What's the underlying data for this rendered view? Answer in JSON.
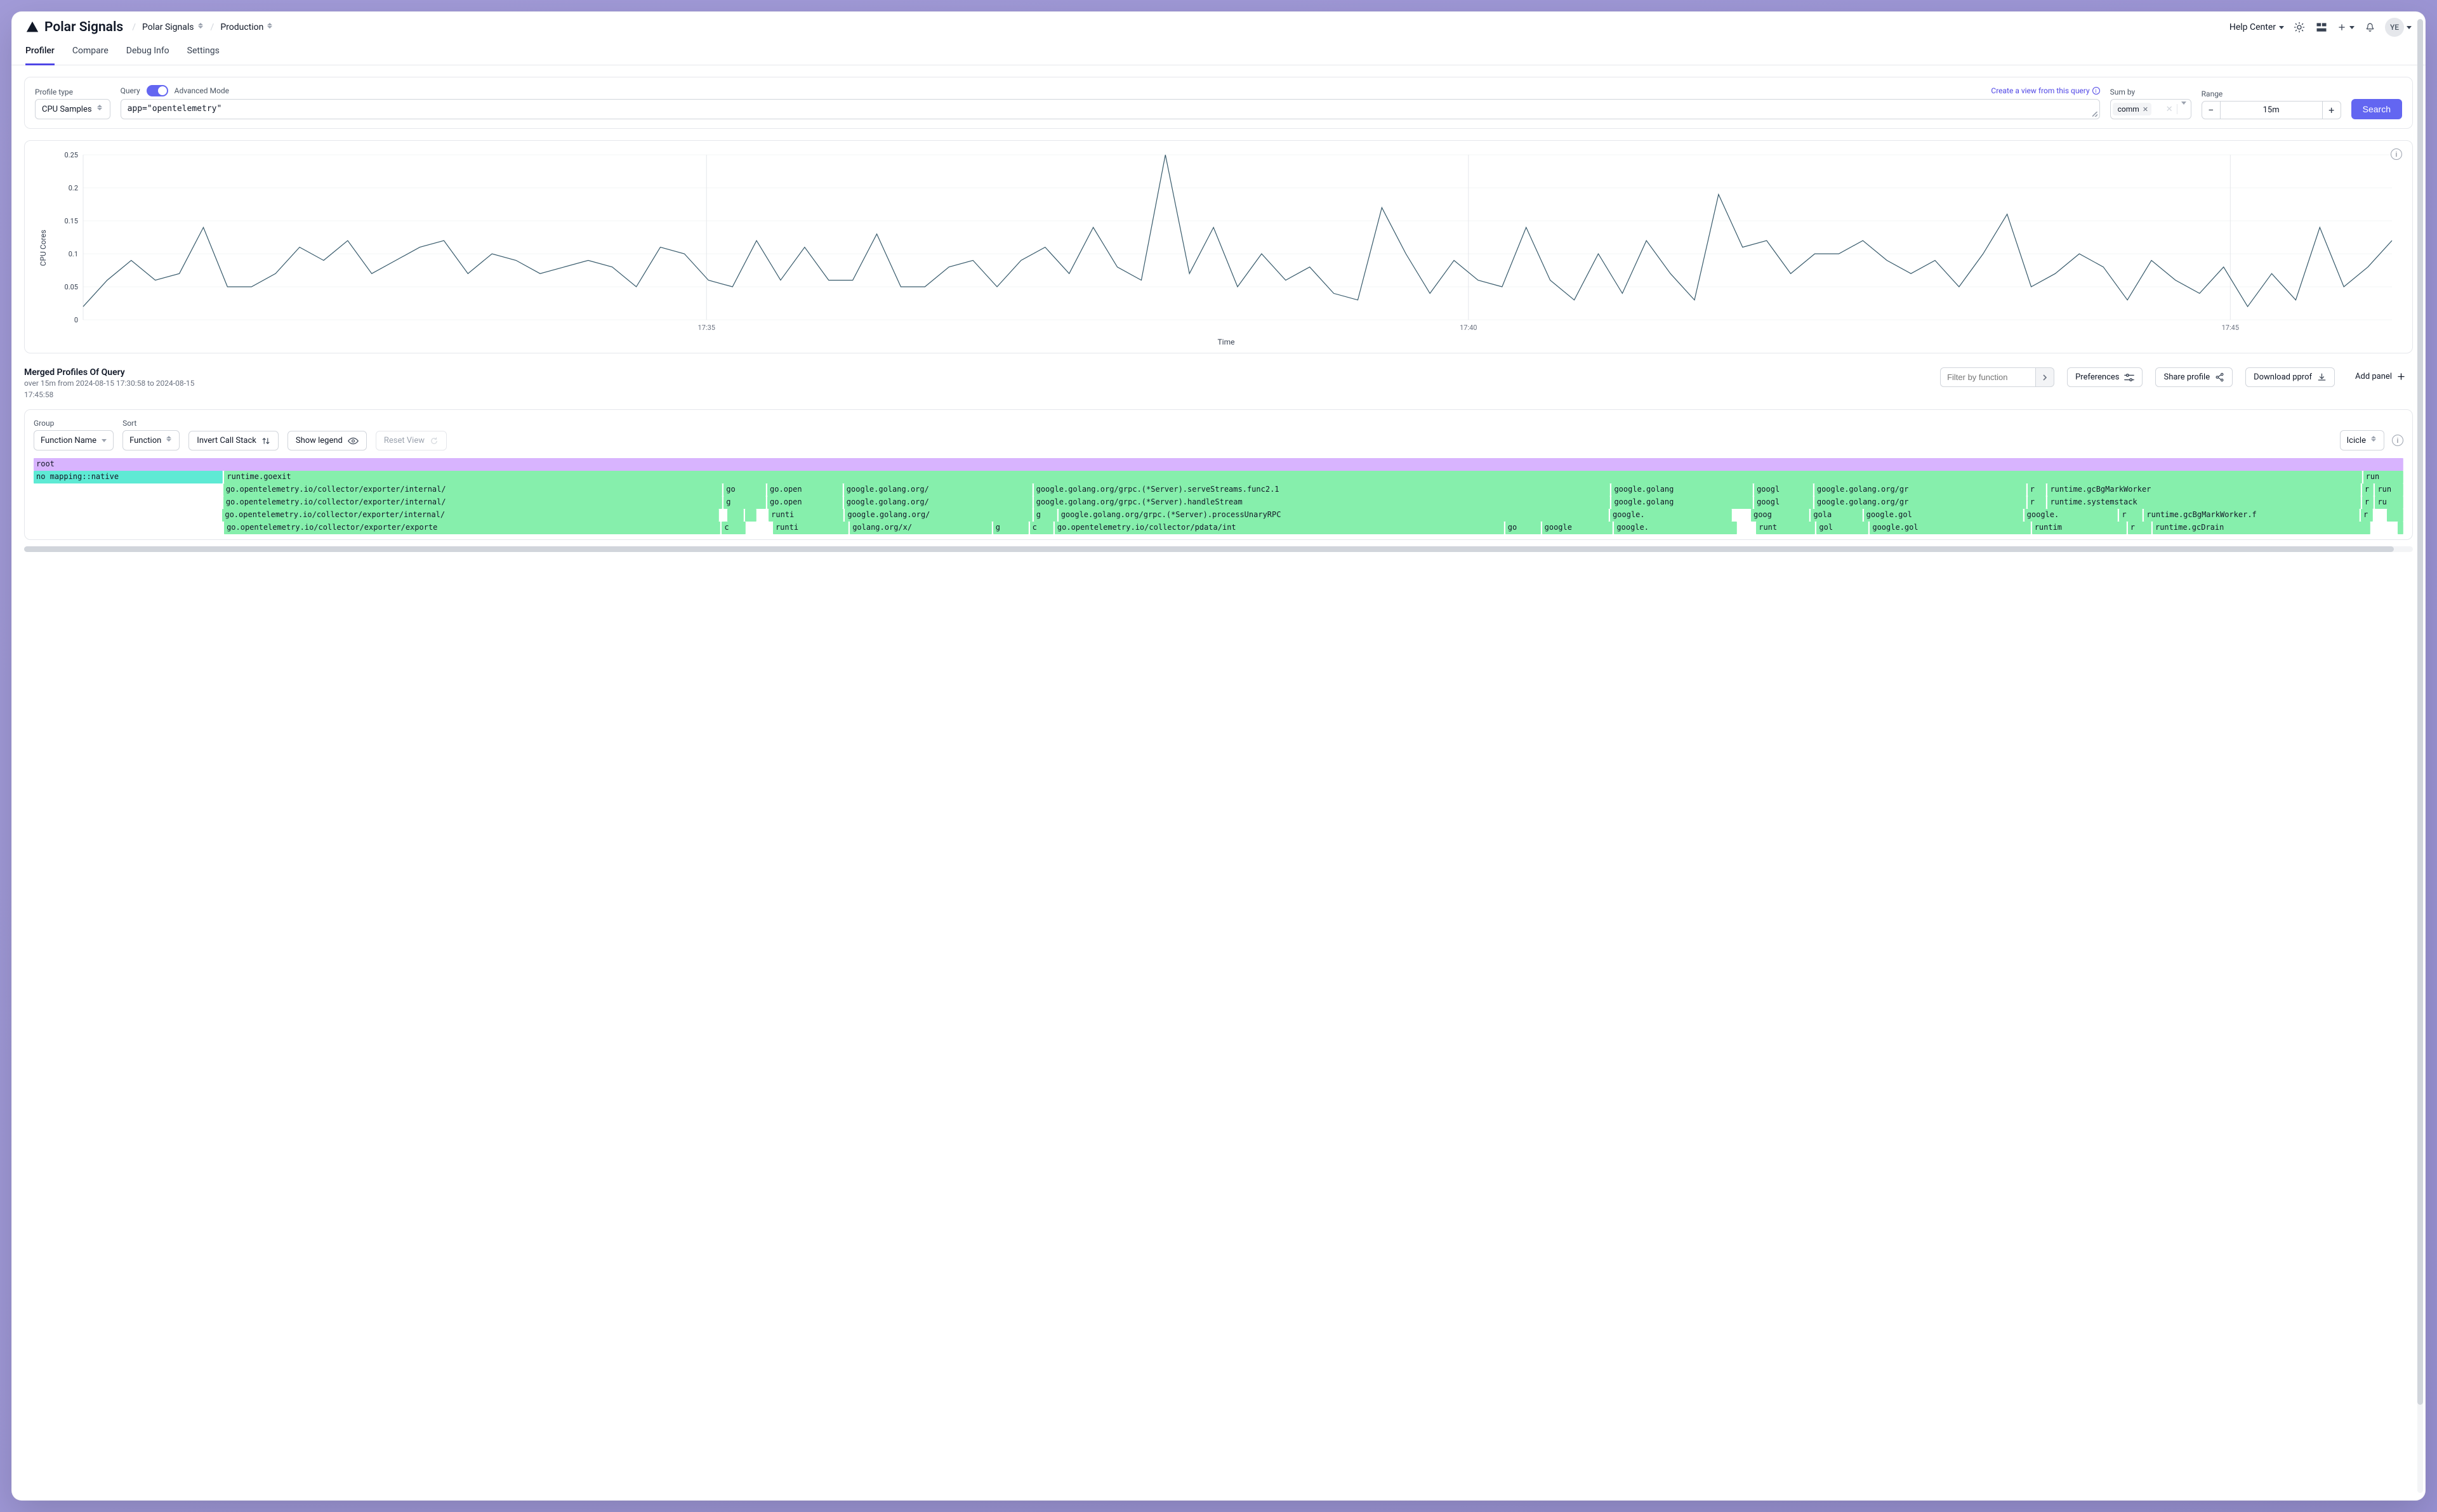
{
  "brand": "Polar Signals",
  "breadcrumbs": {
    "org": "Polar Signals",
    "project": "Production"
  },
  "header": {
    "help_label": "Help Center",
    "avatar_initials": "YE"
  },
  "tabs": [
    "Profiler",
    "Compare",
    "Debug Info",
    "Settings"
  ],
  "active_tab": 0,
  "query_bar": {
    "profile_type_label": "Profile type",
    "profile_type_value": "CPU Samples",
    "query_label": "Query",
    "advanced_mode_label": "Advanced Mode",
    "query_value": "app=\"opentelemetry\"",
    "create_view_label": "Create a view from this query",
    "sum_by_label": "Sum by",
    "sum_by_chips": [
      "comm"
    ],
    "range_label": "Range",
    "range_value": "15m",
    "search_label": "Search"
  },
  "chart_data": {
    "type": "line",
    "title": "",
    "xlabel": "Time",
    "ylabel": "CPU Cores",
    "ylim": [
      0,
      0.25
    ],
    "yticks": [
      0,
      0.05,
      0.1,
      0.15,
      0.2,
      0.25
    ],
    "x_major_labels": [
      "17:35",
      "17:40",
      "17:45"
    ],
    "x_major_positions": [
      0.27,
      0.6,
      0.93
    ],
    "series": [
      {
        "name": "CPU Cores",
        "values": [
          0.02,
          0.06,
          0.09,
          0.06,
          0.07,
          0.14,
          0.05,
          0.05,
          0.07,
          0.11,
          0.09,
          0.12,
          0.07,
          0.09,
          0.11,
          0.12,
          0.07,
          0.1,
          0.09,
          0.07,
          0.08,
          0.09,
          0.08,
          0.05,
          0.11,
          0.1,
          0.06,
          0.05,
          0.12,
          0.06,
          0.11,
          0.06,
          0.06,
          0.13,
          0.05,
          0.05,
          0.08,
          0.09,
          0.05,
          0.09,
          0.11,
          0.07,
          0.14,
          0.08,
          0.06,
          0.25,
          0.07,
          0.14,
          0.05,
          0.1,
          0.06,
          0.08,
          0.04,
          0.03,
          0.17,
          0.1,
          0.04,
          0.09,
          0.06,
          0.05,
          0.14,
          0.06,
          0.03,
          0.1,
          0.04,
          0.12,
          0.07,
          0.03,
          0.19,
          0.11,
          0.12,
          0.07,
          0.1,
          0.1,
          0.12,
          0.09,
          0.07,
          0.09,
          0.05,
          0.1,
          0.16,
          0.05,
          0.07,
          0.1,
          0.08,
          0.03,
          0.09,
          0.06,
          0.04,
          0.08,
          0.02,
          0.07,
          0.03,
          0.14,
          0.05,
          0.08,
          0.12
        ]
      }
    ]
  },
  "merged": {
    "title": "Merged Profiles Of Query",
    "subtitle": "over 15m from 2024-08-15 17:30:58 to 2024-08-15 17:45:58",
    "filter_placeholder": "Filter by function",
    "preferences_label": "Preferences",
    "share_label": "Share profile",
    "download_label": "Download pprof",
    "add_panel_label": "Add panel"
  },
  "flame_controls": {
    "group_label": "Group",
    "group_value": "Function Name",
    "sort_label": "Sort",
    "sort_value": "Function",
    "invert_label": "Invert Call Stack",
    "legend_label": "Show legend",
    "reset_label": "Reset View",
    "view_type": "Icicle"
  },
  "flamegraph": {
    "rows": [
      [
        {
          "w": 100,
          "cls": "froot",
          "t": "root"
        }
      ],
      [
        {
          "w": 8.0,
          "cls": "fnative",
          "t": "no mapping::native"
        },
        {
          "w": 90.3,
          "cls": "fg",
          "t": "runtime.goexit"
        },
        {
          "w": 1.7,
          "cls": "fg",
          "t": "run"
        }
      ],
      [
        {
          "w": 8.0,
          "cls": "fgap",
          "t": ""
        },
        {
          "w": 21.2,
          "cls": "fg",
          "t": "go.opentelemetry.io/collector/exporter/internal/"
        },
        {
          "w": 1.8,
          "cls": "fg",
          "t": "go"
        },
        {
          "w": 3.2,
          "cls": "fg",
          "t": "go.open"
        },
        {
          "w": 8.0,
          "cls": "fg",
          "t": "google.golang.org/"
        },
        {
          "w": 24.5,
          "cls": "fg",
          "t": "google.golang.org/grpc.(*Server).serveStreams.func2.1"
        },
        {
          "w": 6.0,
          "cls": "fg",
          "t": "google.golang"
        },
        {
          "w": 2.5,
          "cls": "fg",
          "t": "googl"
        },
        {
          "w": 9.0,
          "cls": "fg",
          "t": "google.golang.org/gr"
        },
        {
          "w": 0.8,
          "cls": "fg",
          "t": "r"
        },
        {
          "w": 13.3,
          "cls": "fg",
          "t": "runtime.gcBgMarkWorker"
        },
        {
          "w": 0.5,
          "cls": "fg",
          "t": "r"
        },
        {
          "w": 1.2,
          "cls": "fg",
          "t": "run"
        }
      ],
      [
        {
          "w": 8.0,
          "cls": "fgap",
          "t": ""
        },
        {
          "w": 21.2,
          "cls": "fg",
          "t": "go.opentelemetry.io/collector/exporter/internal/"
        },
        {
          "w": 1.8,
          "cls": "fg",
          "t": "g"
        },
        {
          "w": 3.2,
          "cls": "fg",
          "t": "go.open"
        },
        {
          "w": 8.0,
          "cls": "fg",
          "t": "google.golang.org/"
        },
        {
          "w": 24.5,
          "cls": "fg",
          "t": "google.golang.org/grpc.(*Server).handleStream"
        },
        {
          "w": 6.0,
          "cls": "fg",
          "t": "google.golang"
        },
        {
          "w": 2.5,
          "cls": "fg",
          "t": "googl"
        },
        {
          "w": 9.0,
          "cls": "fg",
          "t": "google.golang.org/gr"
        },
        {
          "w": 0.8,
          "cls": "fg",
          "t": "r"
        },
        {
          "w": 13.3,
          "cls": "fg",
          "t": "runtime.systemstack"
        },
        {
          "w": 0.5,
          "cls": "fg",
          "t": "r"
        },
        {
          "w": 1.2,
          "cls": "fg",
          "t": "ru"
        }
      ],
      [
        {
          "w": 8.0,
          "cls": "fgap",
          "t": ""
        },
        {
          "w": 21.2,
          "cls": "fg",
          "t": "go.opentelemetry.io/collector/exporter/internal/"
        },
        {
          "w": 0.2,
          "cls": "fgap",
          "t": ""
        },
        {
          "w": 0.7,
          "cls": "fg",
          "t": ""
        },
        {
          "w": 0.5,
          "cls": "fg",
          "t": ""
        },
        {
          "w": 0.4,
          "cls": "fgap",
          "t": ""
        },
        {
          "w": 3.2,
          "cls": "fg",
          "t": "runti"
        },
        {
          "w": 8.0,
          "cls": "fg",
          "t": "google.golang.org/"
        },
        {
          "w": 1.0,
          "cls": "fg",
          "t": "g"
        },
        {
          "w": 23.5,
          "cls": "fg",
          "t": "google.golang.org/grpc.(*Server).processUnaryRPC"
        },
        {
          "w": 5.2,
          "cls": "fg",
          "t": "google."
        },
        {
          "w": 0.7,
          "cls": "fgap",
          "t": ""
        },
        {
          "w": 2.5,
          "cls": "fg",
          "t": "goog"
        },
        {
          "w": 2.2,
          "cls": "fg",
          "t": "gola"
        },
        {
          "w": 6.8,
          "cls": "fg",
          "t": "google.gol"
        },
        {
          "w": 4.0,
          "cls": "fg",
          "t": "google."
        },
        {
          "w": 1.0,
          "cls": "fg",
          "t": "r"
        },
        {
          "w": 9.2,
          "cls": "fg",
          "t": "runtime.gcBgMarkWorker.f"
        },
        {
          "w": 0.5,
          "cls": "fg",
          "t": "r"
        },
        {
          "w": 0.5,
          "cls": "fgap",
          "t": ""
        },
        {
          "w": 0.7,
          "cls": "fg",
          "t": ""
        }
      ],
      [
        {
          "w": 8.0,
          "cls": "fgap",
          "t": ""
        },
        {
          "w": 21.0,
          "cls": "fg",
          "t": "go.opentelemetry.io/collector/exporter/exporte"
        },
        {
          "w": 1.0,
          "cls": "fg",
          "t": "c"
        },
        {
          "w": 0.4,
          "cls": "fgap",
          "t": ""
        },
        {
          "w": 0.6,
          "cls": "fgap",
          "t": ""
        },
        {
          "w": 3.2,
          "cls": "fg",
          "t": "runti"
        },
        {
          "w": 6.0,
          "cls": "fg",
          "t": "golang.org/x/"
        },
        {
          "w": 1.5,
          "cls": "fg",
          "t": "g"
        },
        {
          "w": 1.0,
          "cls": "fg",
          "t": "c"
        },
        {
          "w": 19.0,
          "cls": "fg",
          "t": "go.opentelemetry.io/collector/pdata/int"
        },
        {
          "w": 1.5,
          "cls": "fg",
          "t": "go"
        },
        {
          "w": 3.0,
          "cls": "fg",
          "t": "google"
        },
        {
          "w": 5.2,
          "cls": "fg",
          "t": "google."
        },
        {
          "w": 0.7,
          "cls": "fgap",
          "t": ""
        },
        {
          "w": 2.5,
          "cls": "fg",
          "t": "runt"
        },
        {
          "w": 2.2,
          "cls": "fg",
          "t": "gol"
        },
        {
          "w": 6.8,
          "cls": "fg",
          "t": "google.gol"
        },
        {
          "w": 4.0,
          "cls": "fg",
          "t": "runtim"
        },
        {
          "w": 1.0,
          "cls": "fg",
          "t": "r"
        },
        {
          "w": 9.2,
          "cls": "fg",
          "t": "runtime.gcDrain"
        },
        {
          "w": 0.5,
          "cls": "fgap",
          "t": ""
        },
        {
          "w": 0.5,
          "cls": "fgap",
          "t": ""
        },
        {
          "w": 0.2,
          "cls": "fg",
          "t": ""
        }
      ]
    ]
  }
}
